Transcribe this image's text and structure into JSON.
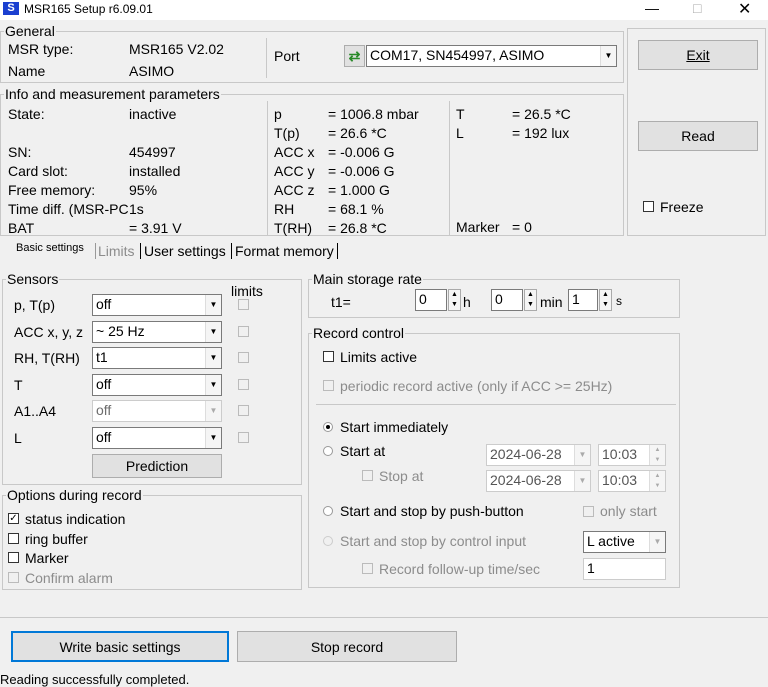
{
  "window": {
    "title": "MSR165 Setup r6.09.01",
    "logo": "S"
  },
  "general": {
    "label": "General",
    "msr_type_label": "MSR type:",
    "msr_type": "MSR165 V2.02",
    "name_label": "Name",
    "name": "ASIMO",
    "port_label": "Port",
    "port_value": "COM17, SN454997, ASIMO"
  },
  "info": {
    "label": "Info and measurement parameters",
    "left": [
      [
        "State:",
        "inactive"
      ],
      [
        "",
        ""
      ],
      [
        "SN:",
        "454997"
      ],
      [
        "Card slot:",
        "installed"
      ],
      [
        "Free memory:",
        "95%"
      ],
      [
        "Time diff. (MSR-PC",
        "1s"
      ],
      [
        "BAT",
        "= 3.91 V"
      ]
    ],
    "mid": [
      [
        "p",
        "= 1006.8 mbar"
      ],
      [
        "T(p)",
        "= 26.6 *C"
      ],
      [
        "ACC x",
        "= -0.006 G"
      ],
      [
        "ACC y",
        "= -0.006 G"
      ],
      [
        "ACC z",
        "= 1.000 G"
      ],
      [
        "RH",
        "= 68.1 %"
      ],
      [
        "T(RH)",
        "= 26.8 *C"
      ]
    ],
    "right": [
      [
        "T",
        "= 26.5 *C"
      ],
      [
        "L",
        "= 192 lux"
      ]
    ],
    "marker_label": "Marker",
    "marker": "= 0"
  },
  "side": {
    "exit": "Exit",
    "read": "Read",
    "freeze": "Freeze"
  },
  "tabs": [
    "Basic settings",
    "Limits",
    "User settings",
    "Format memory"
  ],
  "sensors": {
    "label": "Sensors",
    "limits_label": "limits",
    "rows": [
      {
        "name": "p, T(p)",
        "value": "off",
        "disabled": false
      },
      {
        "name": "ACC x, y, z",
        "value": "~  25 Hz",
        "disabled": false
      },
      {
        "name": "RH, T(RH)",
        "value": "t1",
        "disabled": false
      },
      {
        "name": "T",
        "value": "off",
        "disabled": false
      },
      {
        "name": "A1..A4",
        "value": "off",
        "disabled": true
      },
      {
        "name": "L",
        "value": "off",
        "disabled": false
      }
    ],
    "prediction": "Prediction"
  },
  "options": {
    "label": "Options during record",
    "items": [
      {
        "label": "status indication",
        "checked": true,
        "disabled": false
      },
      {
        "label": "ring buffer",
        "checked": false,
        "disabled": false
      },
      {
        "label": "Marker",
        "checked": false,
        "disabled": false
      },
      {
        "label": "Confirm alarm",
        "checked": false,
        "disabled": true
      }
    ]
  },
  "storage": {
    "label": "Main storage rate",
    "t1": "t1=",
    "h": "0",
    "h_unit": "h",
    "min": "0",
    "min_unit": "min",
    "s": "1",
    "s_unit": "s"
  },
  "record": {
    "label": "Record control",
    "limits_active": "Limits active",
    "periodic": "periodic record active (only if ACC >= 25Hz)",
    "start_immediately": "Start immediately",
    "start_at": "Start at",
    "stop_at": "Stop at",
    "start_date": "2024-06-28",
    "start_time": "10:03",
    "stop_date": "2024-06-28",
    "stop_time": "10:03",
    "push_button": "Start and stop by push-button",
    "only_start": "only start",
    "control_input": "Start and stop by control input",
    "control_value": "L active",
    "follow_up": "Record follow-up time/sec",
    "follow_up_value": "1"
  },
  "buttons": {
    "write": "Write basic settings",
    "stop": "Stop record"
  },
  "status": "Reading successfully completed."
}
